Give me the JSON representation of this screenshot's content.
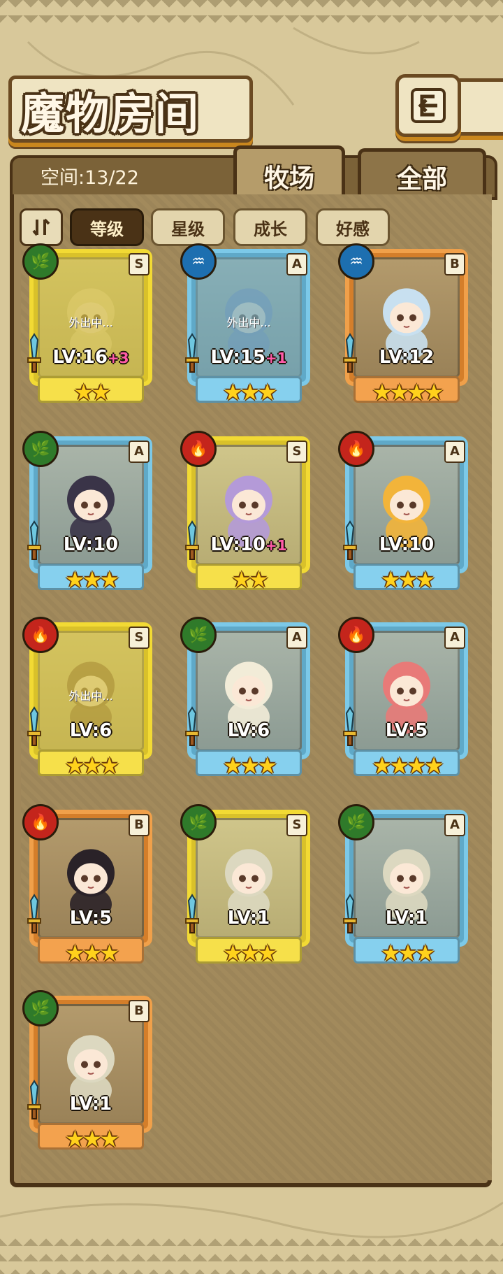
{
  "header": {
    "title": "魔物房间",
    "back_icon": "return-icon"
  },
  "tabs": {
    "space_label": "空间:13/22",
    "items": [
      {
        "label": "牧场",
        "active": true
      },
      {
        "label": "全部",
        "active": false
      }
    ]
  },
  "filters": {
    "items": [
      {
        "label": "等级",
        "active": true
      },
      {
        "label": "星级",
        "active": false
      },
      {
        "label": "成长",
        "active": false
      },
      {
        "label": "好感",
        "active": false
      }
    ]
  },
  "colors": {
    "rank_S": "#f2da34",
    "rank_A": "#7cc9e8",
    "rank_B": "#f0a04a",
    "element_grass": "#2f7a2a",
    "element_water": "#1d6fb0",
    "element_fire": "#c4251c"
  },
  "monsters": [
    {
      "element": "grass",
      "rank": "S",
      "level": "LV:16",
      "bonus": "+3",
      "stars": 2,
      "status": "外出中..."
    },
    {
      "element": "water",
      "rank": "A",
      "level": "LV:15",
      "bonus": "+1",
      "stars": 3,
      "status": "外出中..."
    },
    {
      "element": "water",
      "rank": "B",
      "level": "LV:12",
      "bonus": "",
      "stars": 4,
      "status": ""
    },
    {
      "element": "grass",
      "rank": "A",
      "level": "LV:10",
      "bonus": "",
      "stars": 3,
      "status": ""
    },
    {
      "element": "fire",
      "rank": "S",
      "level": "LV:10",
      "bonus": "+1",
      "stars": 2,
      "status": ""
    },
    {
      "element": "fire",
      "rank": "A",
      "level": "LV:10",
      "bonus": "",
      "stars": 3,
      "status": ""
    },
    {
      "element": "fire",
      "rank": "S",
      "level": "LV:6",
      "bonus": "",
      "stars": 3,
      "status": "外出中..."
    },
    {
      "element": "grass",
      "rank": "A",
      "level": "LV:6",
      "bonus": "",
      "stars": 3,
      "status": ""
    },
    {
      "element": "fire",
      "rank": "A",
      "level": "LV:5",
      "bonus": "",
      "stars": 4,
      "status": ""
    },
    {
      "element": "fire",
      "rank": "B",
      "level": "LV:5",
      "bonus": "",
      "stars": 3,
      "status": ""
    },
    {
      "element": "grass",
      "rank": "S",
      "level": "LV:1",
      "bonus": "",
      "stars": 3,
      "status": ""
    },
    {
      "element": "grass",
      "rank": "A",
      "level": "LV:1",
      "bonus": "",
      "stars": 3,
      "status": ""
    },
    {
      "element": "grass",
      "rank": "B",
      "level": "LV:1",
      "bonus": "",
      "stars": 3,
      "status": ""
    }
  ]
}
